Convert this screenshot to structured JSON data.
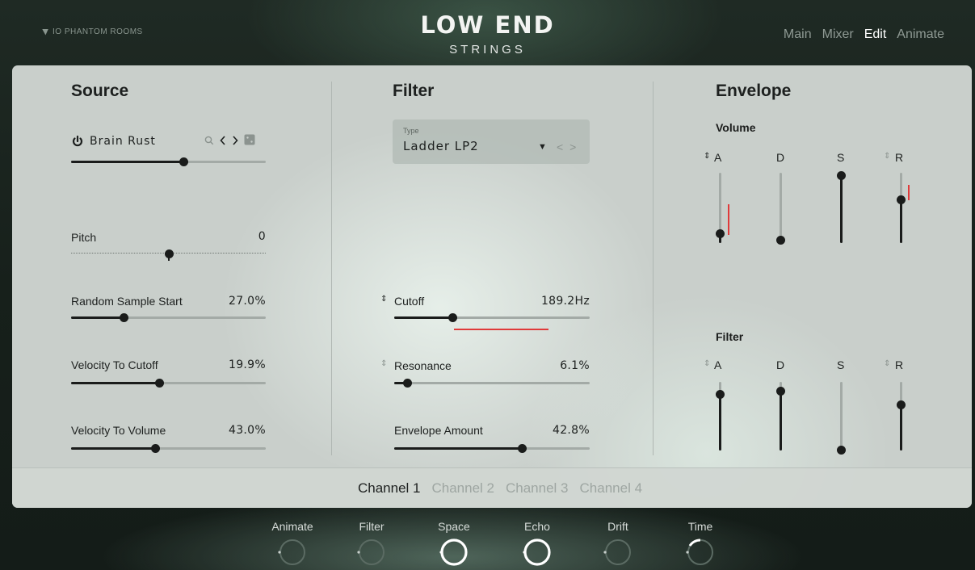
{
  "header": {
    "brand": "IO PHANTOM ROOMS",
    "title": "LOW END",
    "subtitle": "STRINGS",
    "nav": [
      "Main",
      "Mixer",
      "Edit",
      "Animate"
    ],
    "nav_active": "Edit"
  },
  "source": {
    "title": "Source",
    "sample_name": "Brain Rust",
    "sample_level": 0.57,
    "pitch_label": "Pitch",
    "pitch_value": "0",
    "random_start_label": "Random Sample Start",
    "random_start_value": "27.0%",
    "vel_cutoff_label": "Velocity To Cutoff",
    "vel_cutoff_value": "19.9%",
    "vel_volume_label": "Velocity To Volume",
    "vel_volume_value": "43.0%"
  },
  "filter": {
    "title": "Filter",
    "type_label": "Type",
    "type_value": "Ladder LP2",
    "cutoff_label": "Cutoff",
    "cutoff_value": "189.2Hz",
    "resonance_label": "Resonance",
    "resonance_value": "6.1%",
    "env_amount_label": "Envelope Amount",
    "env_amount_value": "42.8%"
  },
  "envelope": {
    "title": "Envelope",
    "volume_title": "Volume",
    "filter_title": "Filter",
    "labels": [
      "A",
      "D",
      "S",
      "R"
    ]
  },
  "channels": {
    "tabs": [
      "Channel 1",
      "Channel 2",
      "Channel 3",
      "Channel 4"
    ],
    "active": "Channel 1"
  },
  "fx": {
    "labels": [
      "Animate",
      "Filter",
      "Space",
      "Echo",
      "Drift",
      "Time"
    ]
  },
  "colors": {
    "accent_mod": "#e03a3a",
    "slider_dark": "#1a1c1b",
    "panel_bg": "#c9cfcb"
  }
}
